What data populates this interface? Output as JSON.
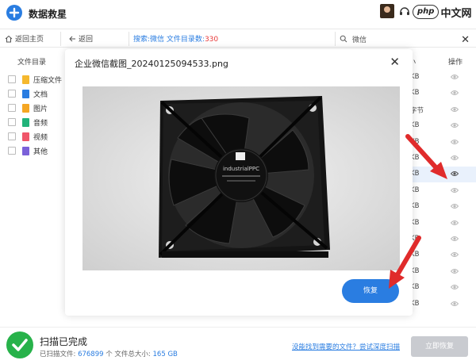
{
  "app": {
    "title": "数据救星"
  },
  "brand": {
    "badge": "php",
    "text": "中文网"
  },
  "toolbar": {
    "home_label": "返回主页",
    "back_label": "返回",
    "search_prefix": "搜索:微信 文件目录数:",
    "search_count": "330",
    "search_placeholder": "微信"
  },
  "sidebar": {
    "title": "文件目录",
    "items": [
      {
        "label": "压缩文件",
        "icon": "folder-icon",
        "color": "#f5b82e"
      },
      {
        "label": "文档",
        "icon": "document-icon",
        "color": "#2a7de1"
      },
      {
        "label": "图片",
        "icon": "image-icon",
        "color": "#f5a623"
      },
      {
        "label": "音频",
        "icon": "audio-icon",
        "color": "#21b37a"
      },
      {
        "label": "视频",
        "icon": "video-icon",
        "color": "#f0566a"
      },
      {
        "label": "其他",
        "icon": "other-icon",
        "color": "#7b61d9"
      }
    ]
  },
  "ops": {
    "col_header_partial": "小",
    "col_header": "操作",
    "rows": [
      {
        "size": "KB"
      },
      {
        "size": "KB"
      },
      {
        "size": "字节"
      },
      {
        "size": "KB"
      },
      {
        "size": "KB"
      },
      {
        "size": "KB"
      },
      {
        "size": "KB",
        "highlighted": true
      },
      {
        "size": "KB"
      },
      {
        "size": "KB"
      },
      {
        "size": "KB"
      },
      {
        "size": "KB"
      },
      {
        "size": "KB"
      },
      {
        "size": "KB"
      },
      {
        "size": "KB"
      },
      {
        "size": "KB"
      }
    ]
  },
  "modal": {
    "title": "企业微信截图_20240125094533.png",
    "restore_label": "恢复",
    "fan_label": "industrialPPC"
  },
  "status": {
    "title": "扫描已完成",
    "scanned_label": "已扫描文件:",
    "scanned_count": "676899",
    "scanned_unit": "个 文件总大小:",
    "total_size": "165 GB",
    "deep_scan_link": "没能找到需要的文件？尝试深度扫描",
    "instant_restore_label": "立即恢复"
  },
  "colors": {
    "accent": "#2a7de1",
    "success": "#27b24a",
    "arrow": "#e02b2b"
  }
}
